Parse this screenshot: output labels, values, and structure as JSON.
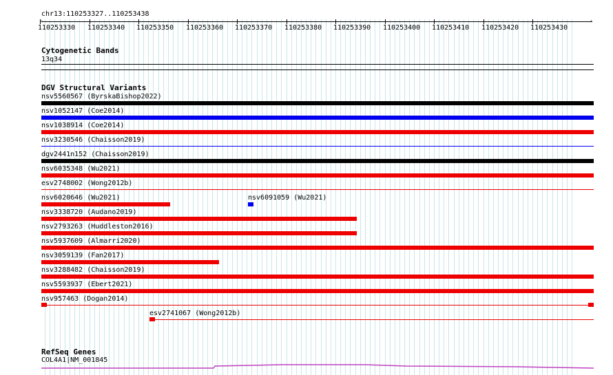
{
  "ruler": {
    "position": "chr13:110253327..110253438",
    "ticks": [
      "110253330",
      "110253340",
      "110253350",
      "110253360",
      "110253370",
      "110253380",
      "110253390",
      "110253400",
      "110253410",
      "110253420",
      "110253430"
    ]
  },
  "tracks": {
    "cytoband": {
      "title": "Cytogenetic Bands",
      "band": "13q34"
    },
    "dgv": {
      "title": "DGV Structural Variants",
      "features": [
        {
          "label": "nsv5560567 (ByrskaBishop2022)",
          "color": "#000000",
          "type": "bar"
        },
        {
          "label": "nsv1052147 (Coe2014)",
          "color": "#0000ee",
          "type": "bar"
        },
        {
          "label": "nsv1038914 (Coe2014)",
          "color": "#ee0000",
          "type": "bar"
        },
        {
          "label": "nsv3230546 (Chaisson2019)",
          "color": "#0000ee",
          "type": "line"
        },
        {
          "label": "dgv2441n152 (Chaisson2019)",
          "color": "#000000",
          "type": "bar"
        },
        {
          "label": "nsv6035348 (Wu2021)",
          "color": "#ee0000",
          "type": "bar"
        },
        {
          "label": "esv2748002 (Wong2012b)",
          "color": "#ee0000",
          "type": "line"
        },
        {
          "label": "nsv6020646 (Wu2021)",
          "color": "#ee0000",
          "type": "bar"
        },
        {
          "label": "nsv6091059 (Wu2021)",
          "color": "#0000ee",
          "type": "bar"
        },
        {
          "label": "nsv3338720 (Audano2019)",
          "color": "#ee0000",
          "type": "bar"
        },
        {
          "label": "nsv2793263 (Huddleston2016)",
          "color": "#ee0000",
          "type": "bar"
        },
        {
          "label": "nsv5937609 (Almarri2020)",
          "color": "#ee0000",
          "type": "bar"
        },
        {
          "label": "nsv3059139 (Fan2017)",
          "color": "#ee0000",
          "type": "bar"
        },
        {
          "label": "nsv3288482 (Chaisson2019)",
          "color": "#ee0000",
          "type": "bar"
        },
        {
          "label": "nsv5593937 (Ebert2021)",
          "color": "#ee0000",
          "type": "bar"
        },
        {
          "label": "nsv957463 (Dogan2014)",
          "color": "#ee0000",
          "type": "blocks"
        },
        {
          "label": "esv2741067 (Wong2012b)",
          "color": "#ee0000",
          "type": "blocks"
        }
      ]
    },
    "refseq": {
      "title": "RefSeq Genes",
      "gene": "COL4A1|NM_001845",
      "color": "#c040c0"
    }
  }
}
